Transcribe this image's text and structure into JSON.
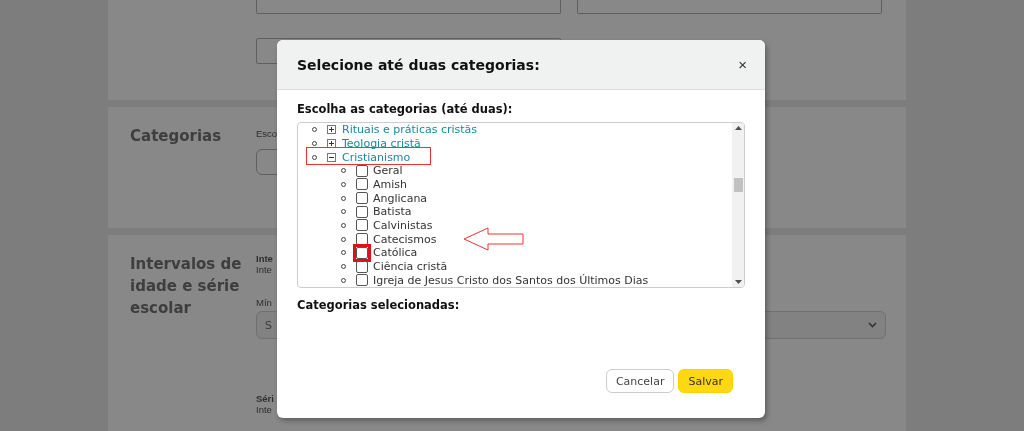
{
  "page": {
    "sections": [
      {
        "title": "Categorias",
        "fields": [
          {
            "label": "Esco"
          }
        ]
      },
      {
        "title": "Intervalos de idade e série escolar",
        "fields": [
          {
            "heading": "Inte",
            "label": "Inte"
          },
          {
            "label": "Mín",
            "value": "S"
          },
          {
            "heading": "Séri",
            "label": "Inte"
          }
        ]
      }
    ]
  },
  "modal": {
    "title": "Selecione até duas categorias:",
    "close": "×",
    "prompt": "Escolha as categorias (até duas):",
    "tree": [
      {
        "kind": "branch",
        "label": "Rituais e práticas cristãs",
        "expanded": false,
        "highlighted": false
      },
      {
        "kind": "branch",
        "label": "Teologia cristã",
        "expanded": false,
        "highlighted": false
      },
      {
        "kind": "branch",
        "label": "Cristianismo",
        "expanded": true,
        "highlighted": true,
        "children": [
          {
            "kind": "leaf",
            "label": "Geral",
            "checked": false,
            "highlighted": false
          },
          {
            "kind": "leaf",
            "label": "Amish",
            "checked": false,
            "highlighted": false
          },
          {
            "kind": "leaf",
            "label": "Anglicana",
            "checked": false,
            "highlighted": false
          },
          {
            "kind": "leaf",
            "label": "Batista",
            "checked": false,
            "highlighted": false
          },
          {
            "kind": "leaf",
            "label": "Calvinistas",
            "checked": false,
            "highlighted": false
          },
          {
            "kind": "leaf",
            "label": "Catecismos",
            "checked": false,
            "highlighted": false
          },
          {
            "kind": "leaf",
            "label": "Católica",
            "checked": false,
            "highlighted": true
          },
          {
            "kind": "leaf",
            "label": "Ciência cristã",
            "checked": false,
            "highlighted": false
          },
          {
            "kind": "leaf",
            "label": "Igreja de Jesus Cristo dos Santos dos Últimos Dias",
            "checked": false,
            "highlighted": false
          }
        ]
      }
    ],
    "selected_heading": "Categorias selecionadas:",
    "buttons": [
      {
        "kind": "secondary",
        "label": "Cancelar"
      },
      {
        "kind": "primary",
        "label": "Salvar"
      }
    ]
  }
}
